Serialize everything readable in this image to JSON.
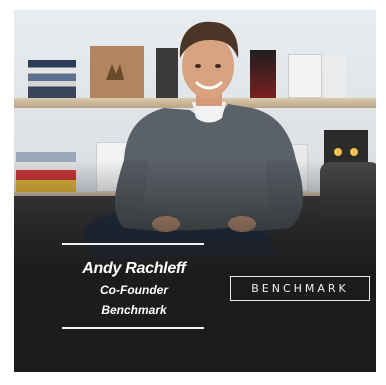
{
  "profile": {
    "name": "Andy Rachleff",
    "title": "Co-Founder",
    "company": "Benchmark"
  },
  "logo": {
    "text": "BENCHMARK"
  }
}
